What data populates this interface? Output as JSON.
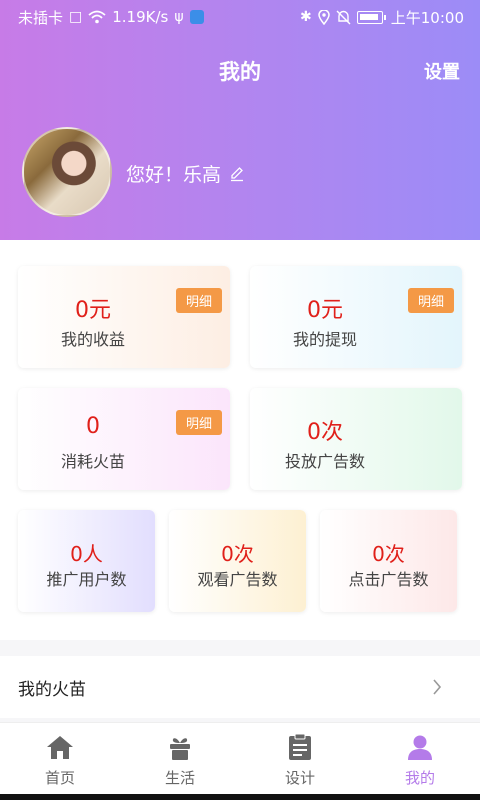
{
  "status_bar": {
    "carrier": "未插卡",
    "speed": "1.19K/s",
    "time": "上午10:00"
  },
  "header": {
    "title": "我的",
    "settings_label": "设置"
  },
  "profile": {
    "greeting": "您好！乐高"
  },
  "stats": {
    "earnings": {
      "value": "0元",
      "label": "我的收益",
      "badge": "明细"
    },
    "withdrawals": {
      "value": "0元",
      "label": "我的提现",
      "badge": "明细"
    },
    "seedlings_used": {
      "value": "0",
      "label": "消耗火苗",
      "badge": "明细"
    },
    "ads_placed": {
      "value": "0次",
      "label": "投放广告数"
    },
    "referred_users": {
      "value": "0人",
      "label": "推广用户数"
    },
    "ads_watched": {
      "value": "0次",
      "label": "观看广告数"
    },
    "ads_clicked": {
      "value": "0次",
      "label": "点击广告数"
    }
  },
  "menu": {
    "my_seedlings": "我的火苗"
  },
  "tabbar": {
    "items": [
      {
        "label": "首页",
        "icon": "home-icon"
      },
      {
        "label": "生活",
        "icon": "gift-plant-icon"
      },
      {
        "label": "设计",
        "icon": "document-icon"
      },
      {
        "label": "我的",
        "icon": "person-icon"
      }
    ],
    "active_color": "#b47be9",
    "inactive_color": "#666666"
  },
  "colors": {
    "header_gradient_start": "#c77be7",
    "header_gradient_end": "#9c8cf7",
    "value_red": "#e0201a",
    "badge_orange": "#f49946"
  }
}
